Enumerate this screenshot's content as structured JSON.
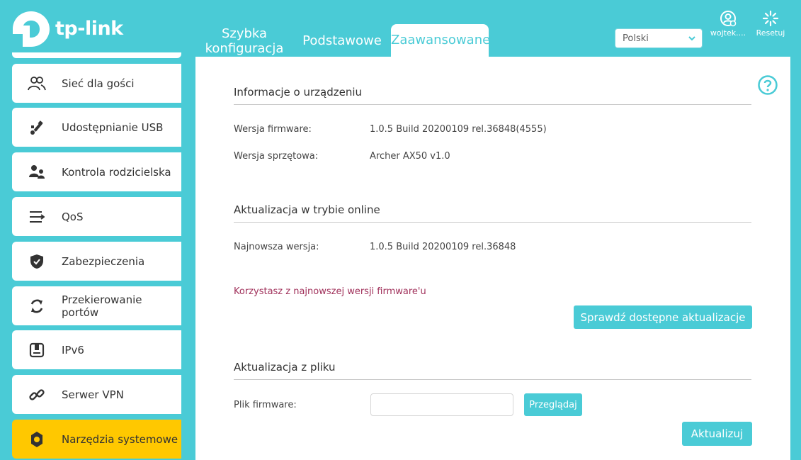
{
  "header": {
    "logo_text": "tp-link",
    "tabs": [
      {
        "label_line1": "Szybka",
        "label_line2": "konfiguracja"
      },
      {
        "label": "Podstawowe"
      },
      {
        "label": "Zaawansowane",
        "active": true
      }
    ],
    "language": "Polski",
    "user_label": "wojtek....",
    "reset_label": "Resetuj"
  },
  "sidebar": {
    "items": [
      {
        "label": "Sieć dla gości",
        "icon": "guests-icon"
      },
      {
        "label": "Udostępnianie USB",
        "icon": "usb-icon"
      },
      {
        "label": "Kontrola rodzicielska",
        "icon": "parental-control-icon"
      },
      {
        "label": "QoS",
        "icon": "qos-icon"
      },
      {
        "label": "Zabezpieczenia",
        "icon": "shield-icon"
      },
      {
        "label_line1": "Przekierowanie",
        "label_line2": "portów",
        "icon": "forwarding-icon"
      },
      {
        "label": "IPv6",
        "icon": "ipv6-icon"
      },
      {
        "label": "Serwer VPN",
        "icon": "link-icon"
      },
      {
        "label": "Narzędzia systemowe",
        "icon": "gear-icon",
        "active": true
      }
    ]
  },
  "device_info": {
    "title": "Informacje o urządzeniu",
    "firmware_label": "Wersja firmware:",
    "firmware_value": "1.0.5 Build 20200109 rel.36848(4555)",
    "hardware_label": "Wersja sprzętowa:",
    "hardware_value": "Archer AX50 v1.0"
  },
  "online_update": {
    "title": "Aktualizacja w trybie online",
    "latest_label": "Najnowsza wersja:",
    "latest_value": "1.0.5 Build 20200109 rel.36848",
    "note": "Korzystasz z najnowszej wersji firmware'u",
    "check_button": "Sprawdź dostępne aktualizacje"
  },
  "file_update": {
    "title": "Aktualizacja z pliku",
    "file_label": "Plik firmware:",
    "file_value": "",
    "browse_button": "Przeglądaj",
    "update_button": "Aktualizuj"
  },
  "colors": {
    "brand": "#4acbd6",
    "active_item": "#ffc800",
    "note": "#a0305a"
  }
}
